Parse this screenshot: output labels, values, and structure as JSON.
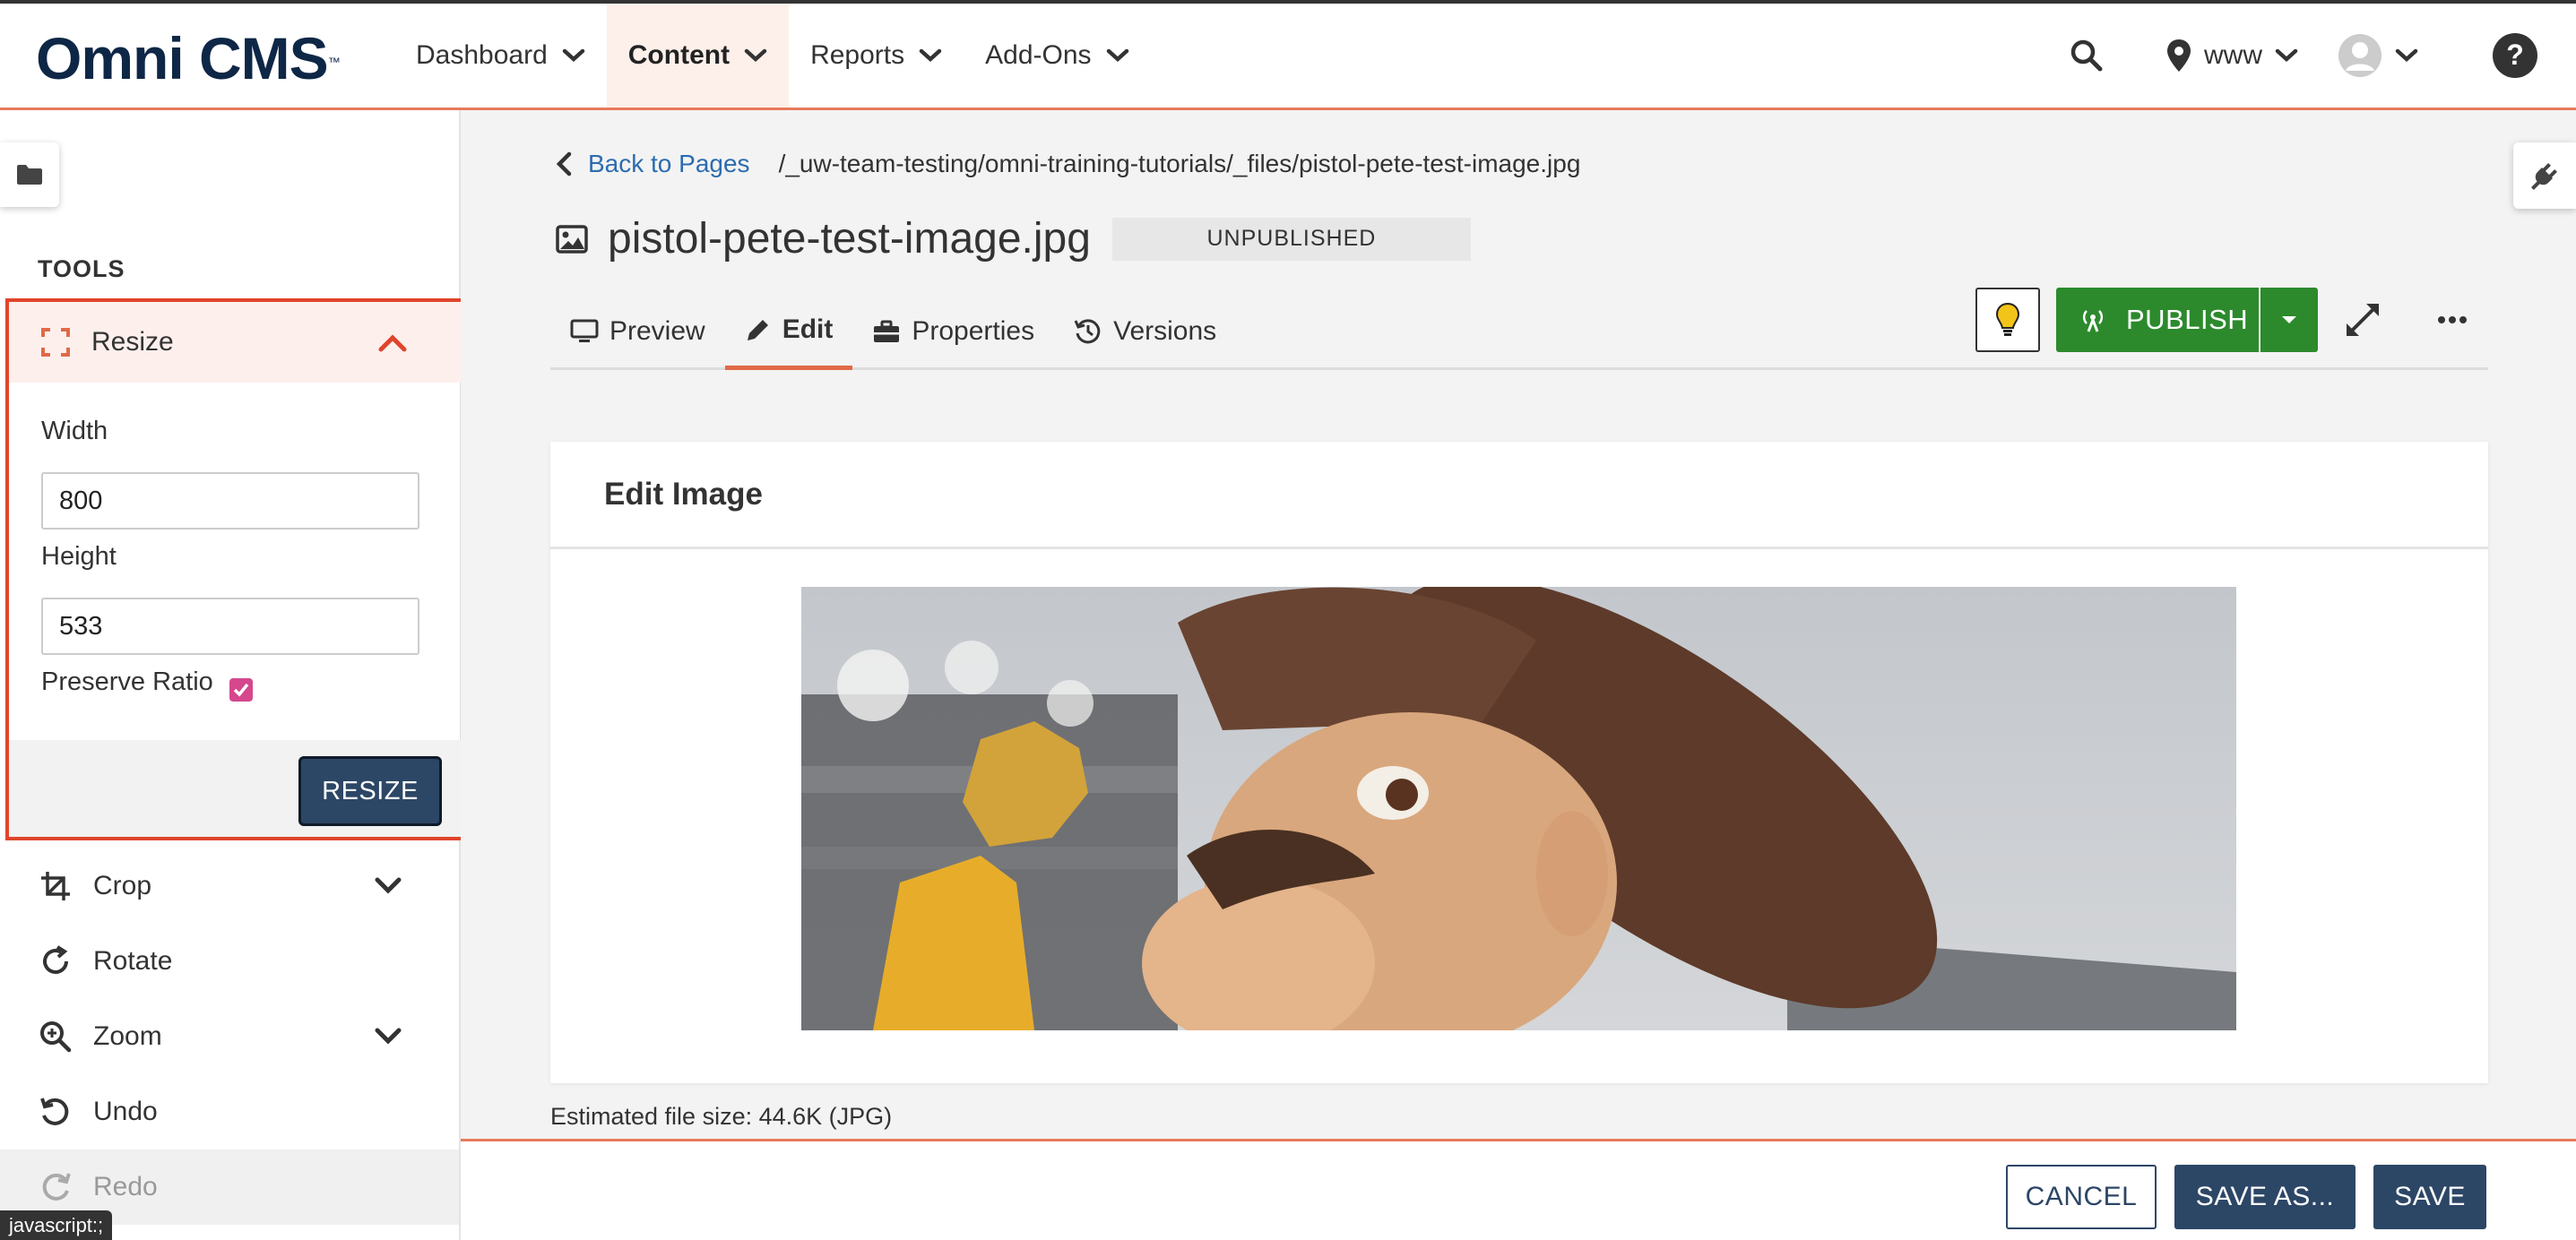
{
  "header": {
    "logo": "Omni CMS",
    "logo_tm": "™",
    "nav": [
      {
        "label": "Dashboard",
        "active": false
      },
      {
        "label": "Content",
        "active": true
      },
      {
        "label": "Reports",
        "active": false
      },
      {
        "label": "Add-Ons",
        "active": false
      }
    ],
    "site_label": "www",
    "icons": [
      "search-icon",
      "location-pin-icon",
      "avatar",
      "help-icon"
    ]
  },
  "sidebar": {
    "tools_heading": "TOOLS",
    "resize": {
      "label": "Resize",
      "width_label": "Width",
      "width_value": "800",
      "height_label": "Height",
      "height_value": "533",
      "preserve_label": "Preserve Ratio",
      "preserve_checked": true,
      "button_label": "RESIZE"
    },
    "tools": [
      {
        "label": "Crop",
        "icon": "crop-icon",
        "expandable": true
      },
      {
        "label": "Rotate",
        "icon": "rotate-icon",
        "expandable": false
      },
      {
        "label": "Zoom",
        "icon": "zoom-icon",
        "expandable": true
      },
      {
        "label": "Undo",
        "icon": "undo-icon",
        "expandable": false
      },
      {
        "label": "Redo",
        "icon": "redo-icon",
        "expandable": false
      }
    ]
  },
  "status_bar": "javascript:;",
  "main": {
    "back_label": "Back to Pages",
    "path": "/_uw-team-testing/omni-training-tutorials/_files/pistol-pete-test-image.jpg",
    "title": "pistol-pete-test-image.jpg",
    "status_badge": "UNPUBLISHED",
    "tabs": [
      {
        "label": "Preview",
        "icon": "monitor-icon"
      },
      {
        "label": "Edit",
        "icon": "pencil-icon",
        "active": true
      },
      {
        "label": "Properties",
        "icon": "toolbox-icon"
      },
      {
        "label": "Versions",
        "icon": "history-icon"
      }
    ],
    "publish_label": "PUBLISH",
    "card_title": "Edit Image",
    "file_size": "Estimated file size: 44.6K (JPG)"
  },
  "footer": {
    "cancel": "CANCEL",
    "save_as": "SAVE AS...",
    "save": "SAVE"
  },
  "colors": {
    "accent": "#e8795a",
    "highlight_border": "#e0452b",
    "primary_button": "#2c4666",
    "publish": "#2c8a2c",
    "link": "#2b6cb0",
    "logo": "#0e2746"
  }
}
